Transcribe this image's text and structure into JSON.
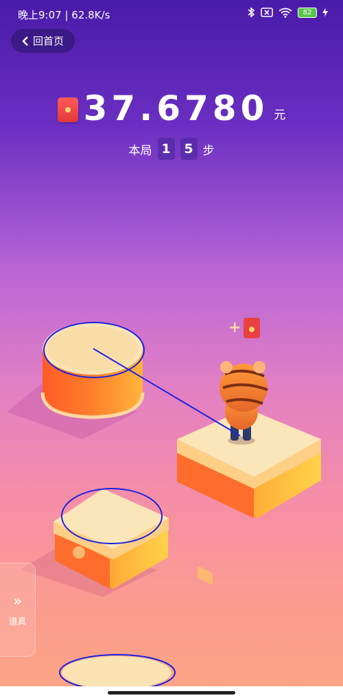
{
  "status_bar": {
    "time": "晚上9:07 | 62.8K/s",
    "battery": "82"
  },
  "header": {
    "back_label": "回首页"
  },
  "score": {
    "value": "37.6780",
    "unit": "元"
  },
  "round": {
    "prefix": "本局",
    "digits": [
      "1",
      "5"
    ],
    "suffix": "步"
  },
  "bonus": {
    "plus": "+"
  },
  "side_tool": {
    "arrow": "»",
    "label": "道具"
  },
  "icons": {
    "back": "chevron-left-icon",
    "bluetooth": "bluetooth-icon",
    "sim": "no-sim-icon",
    "wifi": "wifi-icon",
    "battery": "battery-icon",
    "charging": "charging-icon",
    "red_packet": "red-packet-icon",
    "tool": "double-chevron-icon"
  },
  "colors": {
    "accent_red": "#e94040",
    "platform_top": "#fbe0ad",
    "platform_side": "#ff7a2b",
    "annotation": "#1b22e0"
  }
}
